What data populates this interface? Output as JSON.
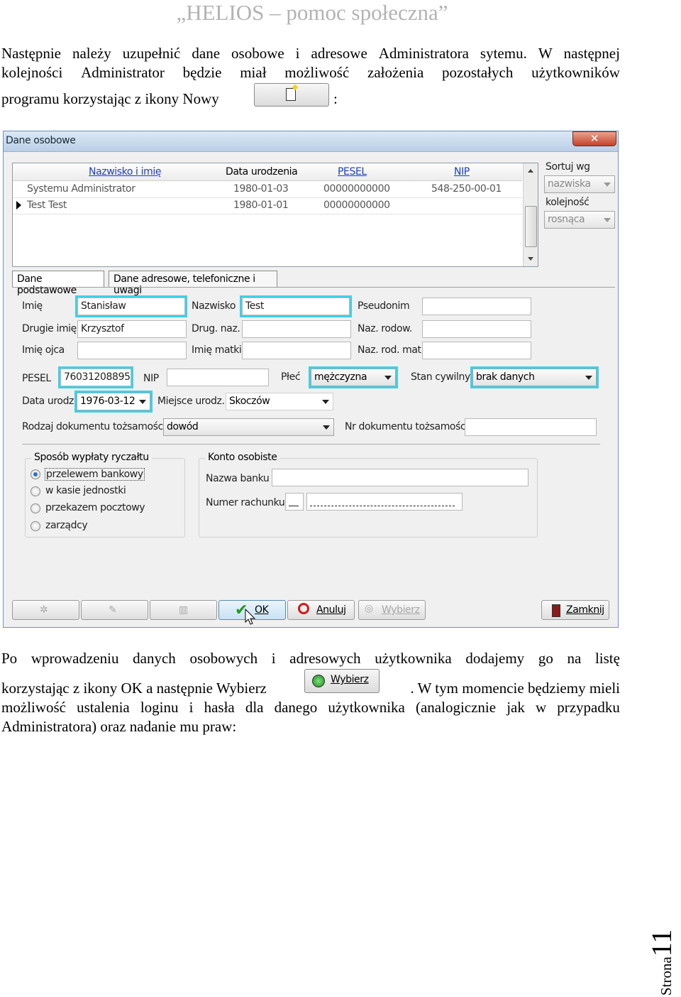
{
  "header": "„HELIOS – pomoc społeczna”",
  "para1": {
    "line1": [
      "Następnie",
      "należy",
      "uzupełnić",
      "dane",
      "osobowe",
      "i",
      "adresowe",
      "Administratora",
      "sytemu.",
      "W",
      "następnej"
    ],
    "line2": [
      "kolejności",
      "Administrator",
      "będzie",
      "miał",
      "możliwość",
      "założenia",
      "pozostałych",
      "użytkowników"
    ],
    "line3_before": "programu korzystając z ikony Nowy",
    "line3_after": ":"
  },
  "window": {
    "title": "Dane osobowe",
    "close": "✕",
    "grid": {
      "headers": [
        "Nazwisko i imię",
        "Data urodzenia",
        "PESEL",
        "NIP"
      ],
      "rows": [
        [
          "Systemu Administrator",
          "1980-01-03",
          "00000000000",
          "548-250-00-01"
        ],
        [
          "Test Test",
          "1980-01-01",
          "00000000000",
          ""
        ]
      ]
    },
    "sort": {
      "label": "Sortuj wg",
      "value": "nazwiska",
      "order_label": "kolejność",
      "order_value": "rosnąca"
    },
    "tabs": [
      "Dane podstawowe",
      "Dane adresowe, telefoniczne i uwagi"
    ],
    "form": {
      "imie_label": "Imię",
      "imie": "Stanisław",
      "nazwisko_label": "Nazwisko",
      "nazwisko": "Test",
      "pseudonim_label": "Pseudonim",
      "drugie_label": "Drugie imię",
      "drugie": "Krzysztof",
      "drug_naz_label": "Drug. naz.",
      "naz_rodow_label": "Naz. rodow.",
      "imie_ojca_label": "Imię ojca",
      "imie_matki_label": "Imię matki",
      "naz_rod_mat_label": "Naz. rod. mat.",
      "pesel_label": "PESEL",
      "pesel": "76031208895",
      "nip_label": "NIP",
      "plec_label": "Płeć",
      "plec": "mężczyzna",
      "stan_label": "Stan cywilny",
      "stan": "brak danych",
      "data_label": "Data urodz.",
      "data": "1976-03-12",
      "miejsce_label": "Miejsce urodz.",
      "miejsce": "Skoczów",
      "rodzaj_label": "Rodzaj dokumentu tożsamości",
      "rodzaj": "dowód",
      "nr_dok_label": "Nr dokumentu tożsamości"
    },
    "payment": {
      "title": "Sposób wypłaty ryczałtu",
      "options": [
        "przelewem bankowy",
        "w kasie jednostki",
        "przekazem pocztowy",
        "zarządcy"
      ]
    },
    "account": {
      "title": "Konto osobiste",
      "bank_label": "Nazwa banku",
      "number_label": "Numer rachunku"
    },
    "buttons": {
      "ok": "OK",
      "anuluj": "Anuluj",
      "wybierz": "Wybierz",
      "zamknij": "Zamknij"
    }
  },
  "para2": {
    "line1": [
      "Po",
      "wprowadzeniu",
      "danych",
      "osobowych",
      "i",
      "adresowych",
      "użytkownika",
      "dodajemy",
      "go",
      "na",
      "listę"
    ],
    "line2_before": "korzystając z ikony OK a następnie Wybierz",
    "inline_button": "Wybierz",
    "line2_after": ". W tym momencie będziemy mieli",
    "line3": [
      "możliwość",
      "ustalenia",
      "loginu",
      "i",
      "hasła",
      "dla",
      "danego",
      "użytkownika",
      "(analogicznie",
      "jak",
      "w",
      "przypadku"
    ],
    "line4": "Administratora) oraz nadanie mu praw:"
  },
  "footer": {
    "label": "Strona",
    "page": "11"
  }
}
